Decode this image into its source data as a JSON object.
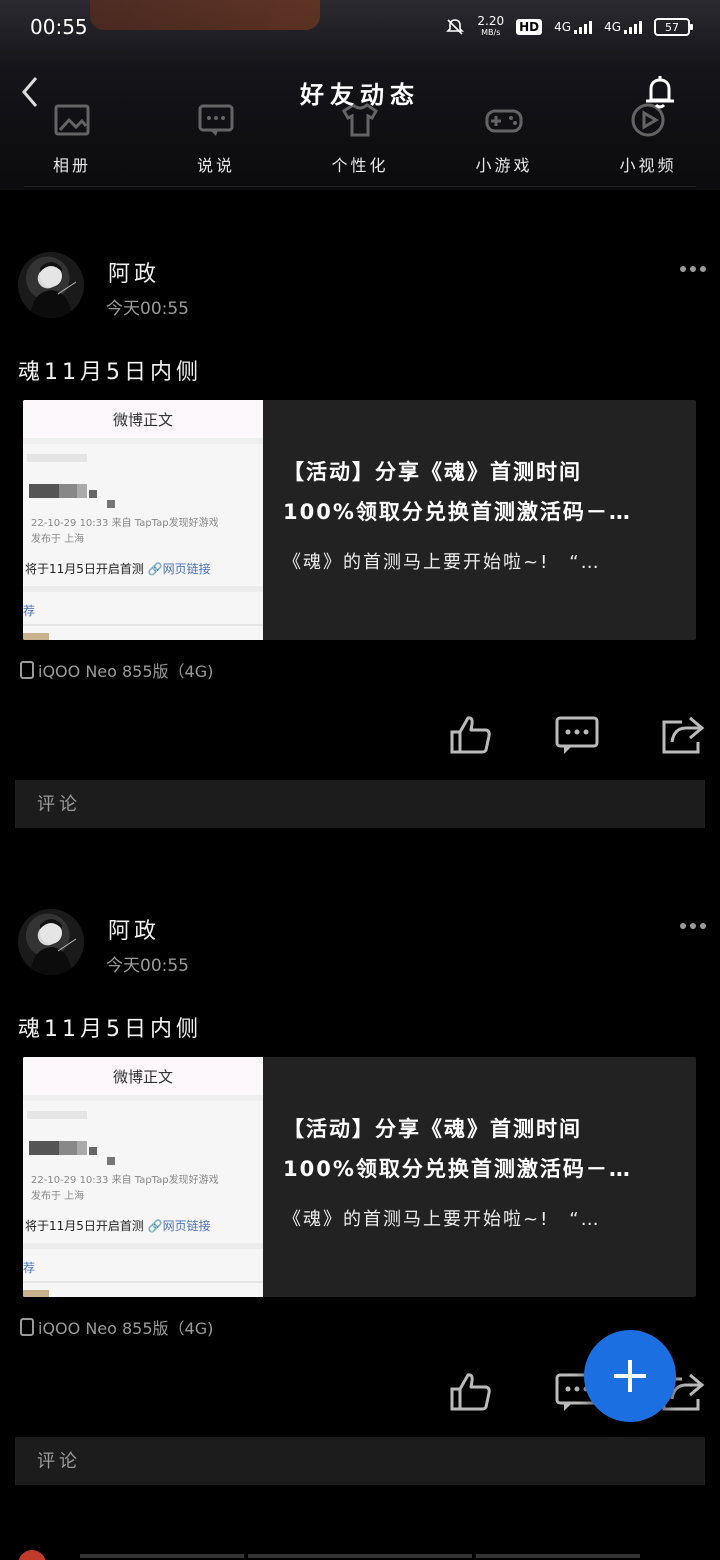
{
  "status_bar": {
    "time": "00:55",
    "net_speed": "2.20",
    "net_unit": "MB/s",
    "hd": "HD",
    "sim1": "4G",
    "sim2": "4G",
    "battery": "57"
  },
  "navbar": {
    "title": "好友动态"
  },
  "quick_nav": [
    {
      "label": "相册",
      "icon": "photo-album-icon"
    },
    {
      "label": "说说",
      "icon": "chat-bubble-icon"
    },
    {
      "label": "个性化",
      "icon": "tshirt-icon"
    },
    {
      "label": "小游戏",
      "icon": "gamepad-icon"
    },
    {
      "label": "小视频",
      "icon": "video-play-icon"
    }
  ],
  "posts": [
    {
      "username": "阿政",
      "time": "今天00:55",
      "text": "魂11月5日内侧",
      "card": {
        "thumb_header": "微博正文",
        "thumb_meta1": "22-10-29 10:33 来自 TapTap发现好游戏",
        "thumb_meta2": "发布于 上海",
        "thumb_line": "将于11月5日开启首测",
        "thumb_link": "🔗网页链接",
        "thumb_rec": "荐",
        "title_line1": "【活动】分享《魂》首测时间",
        "title_line2": "100%领取分兑换首测激活码－…",
        "subtitle": "《魂》的首测马上要开始啦~!　“…"
      },
      "device": "iQOO Neo 855版（4G)",
      "comment_placeholder": "评论"
    },
    {
      "username": "阿政",
      "time": "今天00:55",
      "text": "魂11月5日内侧",
      "card": {
        "thumb_header": "微博正文",
        "thumb_meta1": "22-10-29 10:33 来自 TapTap发现好游戏",
        "thumb_meta2": "发布于 上海",
        "thumb_line": "将于11月5日开启首测",
        "thumb_link": "🔗网页链接",
        "thumb_rec": "荐",
        "title_line1": "【活动】分享《魂》首测时间",
        "title_line2": "100%领取分兑换首测激活码－…",
        "subtitle": "《魂》的首测马上要开始啦~!　“…"
      },
      "device": "iQOO Neo 855版（4G)",
      "comment_placeholder": "评论"
    }
  ],
  "colors": {
    "background": "#000000",
    "fab": "#1b6fe0",
    "card": "#222222",
    "comment_box": "#1c1c1c",
    "muted_text": "#9a9a9a"
  }
}
